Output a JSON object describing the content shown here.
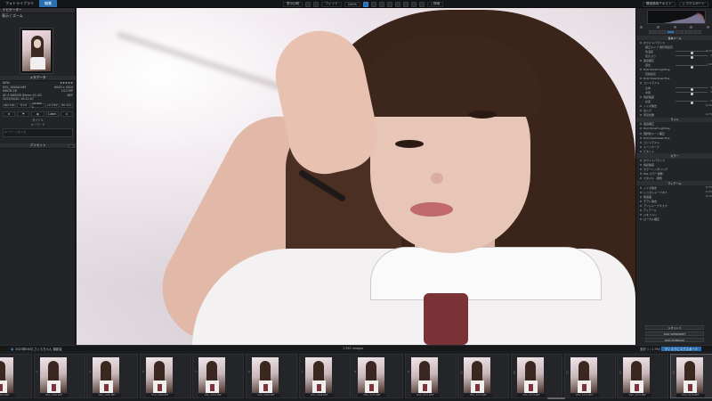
{
  "app": {
    "tabs": [
      {
        "label": "フォトライブラリ"
      },
      {
        "label": "編集",
        "active": true
      }
    ],
    "toolbar": {
      "compare_label": "表示比較",
      "zoom_label": "フィット",
      "zoom_value": "100%",
      "search_label": "検索",
      "export_label": "エクスポート",
      "preset_label": "構造適用テキスト"
    }
  },
  "left_panel": {
    "navigator_title": "ナビゲーター",
    "navigator_tools": "表示 / ズーム",
    "metadata_title": "メタデータ",
    "metadata_rows": [
      {
        "k": "NEW",
        "v": "★★★★★"
      },
      {
        "k": "DSC_00000.NEF",
        "v": "6048 x 4024"
      },
      {
        "k": "NIKON Z6",
        "v": "24.5 MP"
      },
      {
        "k": "AF-S NIKKOR 85mm f/1.4G",
        "v": "NEF"
      },
      {
        "k": "2023/04/01 10:41:07",
        "v": ""
      }
    ],
    "exif": [
      "ISO 100",
      "f/1.6",
      "1/1000 s",
      "+0.3 EV",
      "85 mm"
    ],
    "rating_cells": [
      "★",
      "⚑",
      "◐",
      "Label",
      "⊙"
    ],
    "label_title": "タイトル",
    "keywords_label": "キーワード",
    "keywords_placeholder": "キーワードを入力",
    "presets_title": "プリセット"
  },
  "right_panel": {
    "histogram_label": "ヒストグラム",
    "sections": [
      {
        "type": "head",
        "label": "基本ツール"
      },
      {
        "type": "row",
        "label": "ホワイトバランス"
      },
      {
        "type": "sub",
        "label": "補正タイプ 撮影時設定"
      },
      {
        "type": "sub",
        "label": "色温度",
        "val": "5150"
      },
      {
        "type": "sub",
        "label": "色かぶり",
        "val": "0"
      },
      {
        "type": "row",
        "label": "露出補正"
      },
      {
        "type": "sub",
        "label": "露出",
        "val": "0.00"
      },
      {
        "type": "row",
        "label": "DxO Smart Lighting"
      },
      {
        "type": "sub",
        "label": "自動設定"
      },
      {
        "type": "row",
        "label": "DxO ClearView Plus"
      },
      {
        "type": "row",
        "label": "コントラスト"
      },
      {
        "type": "sub",
        "label": "全体",
        "val": "0"
      },
      {
        "type": "sub",
        "label": "中間",
        "val": "0"
      },
      {
        "type": "row",
        "label": "色彩強度"
      },
      {
        "type": "sub",
        "label": "彩度",
        "val": "0"
      },
      {
        "type": "row",
        "label": "ノイズ除去",
        "val": "AUTO"
      },
      {
        "type": "row",
        "label": "白とび"
      },
      {
        "type": "row",
        "label": "周辺光量",
        "val": "AUTO"
      },
      {
        "type": "head",
        "label": "ライト"
      },
      {
        "type": "row",
        "label": "露出補正"
      },
      {
        "type": "row",
        "label": "DxO Smart Lighting"
      },
      {
        "type": "row",
        "label": "選択的トーン補正"
      },
      {
        "type": "row",
        "label": "DxO ClearView Plus"
      },
      {
        "type": "row",
        "label": "コントラスト"
      },
      {
        "type": "row",
        "label": "トーンカーブ"
      },
      {
        "type": "row",
        "label": "ビネット"
      },
      {
        "type": "head",
        "label": "カラー"
      },
      {
        "type": "row",
        "label": "ホワイトバランス"
      },
      {
        "type": "row",
        "label": "色彩強度"
      },
      {
        "type": "row",
        "label": "カラーレンダリング"
      },
      {
        "type": "row",
        "label": "HSL カラー調整"
      },
      {
        "type": "row",
        "label": "スタイル - 調色"
      },
      {
        "type": "head",
        "label": "ディテール"
      },
      {
        "type": "row",
        "label": "ノイズ除去",
        "val": "AUTO"
      },
      {
        "type": "row",
        "label": "レンズシャープネス",
        "val": "AUTO"
      },
      {
        "type": "row",
        "label": "色収差",
        "val": "AUTO"
      },
      {
        "type": "row",
        "label": "モアレ除去"
      },
      {
        "type": "row",
        "label": "アンシャープマスク"
      },
      {
        "type": "row",
        "label": "ディテール"
      },
      {
        "type": "row",
        "label": "ジオメトリ"
      },
      {
        "type": "row",
        "label": "ローカル補正"
      }
    ],
    "bottom_buttons": [
      "ジオメトリ",
      "DXO VIEWPOINT",
      "DXO FILMPACK"
    ]
  },
  "filmstrip": {
    "folder_label": "2023年04月 さくらちゃん 撮影会",
    "count_label": "1,950 images",
    "info_label": "選択 1 / 1,950",
    "export_button": "ディスクにエクスポート",
    "frames": [
      {
        "num": "1",
        "name": "DSC_3263.NEF"
      },
      {
        "num": "2",
        "name": "DSC_3264.NEF"
      },
      {
        "num": "3",
        "name": "DSC_3265.NEF"
      },
      {
        "num": "4",
        "name": "DSC_3266.NEF"
      },
      {
        "num": "5",
        "name": "DSC_3267.NEF"
      },
      {
        "num": "6",
        "name": "DSC_3268.NEF"
      },
      {
        "num": "7",
        "name": "DSC_3269.NEF"
      },
      {
        "num": "8",
        "name": "DSC_3270.NEF"
      },
      {
        "num": "9",
        "name": "DSC_3271.NEF"
      },
      {
        "num": "10",
        "name": "DSC_3272.NEF"
      },
      {
        "num": "11",
        "name": "DSC_3273.NEF"
      },
      {
        "num": "12",
        "name": "DSC_3274.NEF"
      },
      {
        "num": "13",
        "name": "DSC_3275.NEF"
      },
      {
        "num": "14",
        "name": "DSC_3276.NEF",
        "selected": true
      }
    ]
  },
  "colors": {
    "accent": "#2b6fb0",
    "panel": "#232427",
    "background": "#1b1c1e"
  }
}
